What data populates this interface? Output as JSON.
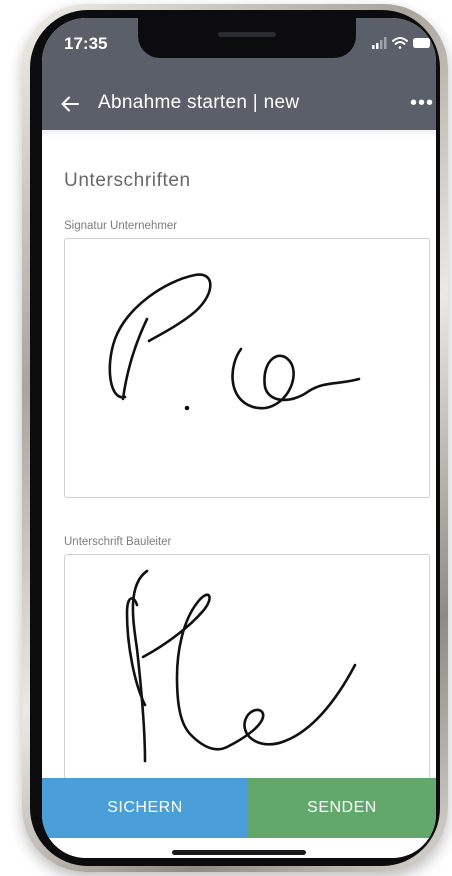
{
  "status_bar": {
    "time": "17:35"
  },
  "header": {
    "title": "Abnahme starten | new",
    "more": "•••"
  },
  "content": {
    "section_title": "Unterschriften",
    "fields": [
      {
        "label": "Signatur Unternehmer"
      },
      {
        "label": "Unterschrift Bauleiter"
      }
    ]
  },
  "footer": {
    "save_label": "SICHERN",
    "send_label": "SENDEN"
  },
  "colors": {
    "header": "#5b5f69",
    "save_button": "#4a9fd8",
    "send_button": "#62a86c"
  },
  "icons": [
    "back-arrow-icon",
    "more-icon",
    "signal-icon",
    "wifi-icon",
    "battery-icon"
  ]
}
